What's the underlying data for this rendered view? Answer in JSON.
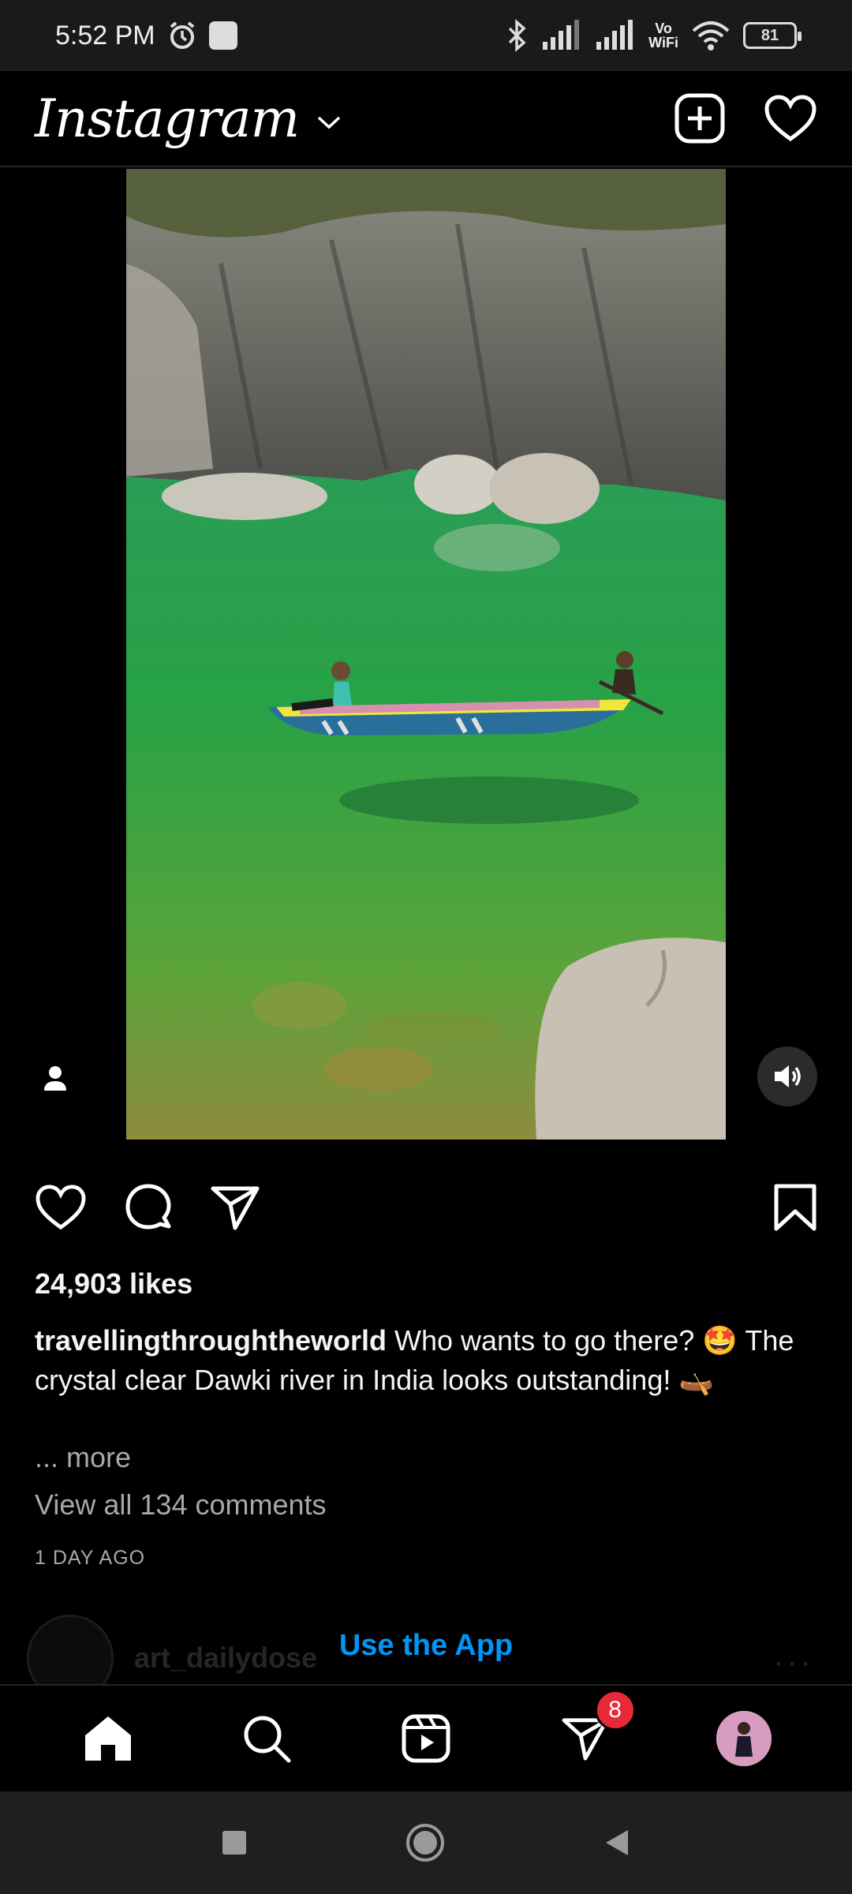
{
  "status_bar": {
    "time": "5:52 PM",
    "battery": "81",
    "vowifi_top": "Vo",
    "vowifi_bottom": "WiFi"
  },
  "header": {
    "logo": "Instagram"
  },
  "post": {
    "likes": "24,903 likes",
    "username": "travellingthroughtheworld",
    "caption": "Who wants to go there? 🤩 The crystal clear Dawki river in India looks outstanding! 🛶",
    "more": "... more",
    "view_comments": "View all 134 comments",
    "time_ago": "1 DAY AGO"
  },
  "next_post": {
    "username": "art_dailydose",
    "menu": "···"
  },
  "use_app": "Use the App",
  "bottom_nav": {
    "dm_badge": "8"
  },
  "colors": {
    "link_blue": "#0095f6",
    "badge_red": "#e8293a",
    "water_green": "#2fa84a"
  },
  "icons": [
    "alarm-icon",
    "bluetooth-icon",
    "signal-icon",
    "wifi-icon",
    "create-icon",
    "heart-icon",
    "comment-icon",
    "share-icon",
    "bookmark-icon",
    "home-icon",
    "search-icon",
    "reels-icon",
    "direct-icon",
    "volume-icon",
    "user-tag-icon"
  ]
}
